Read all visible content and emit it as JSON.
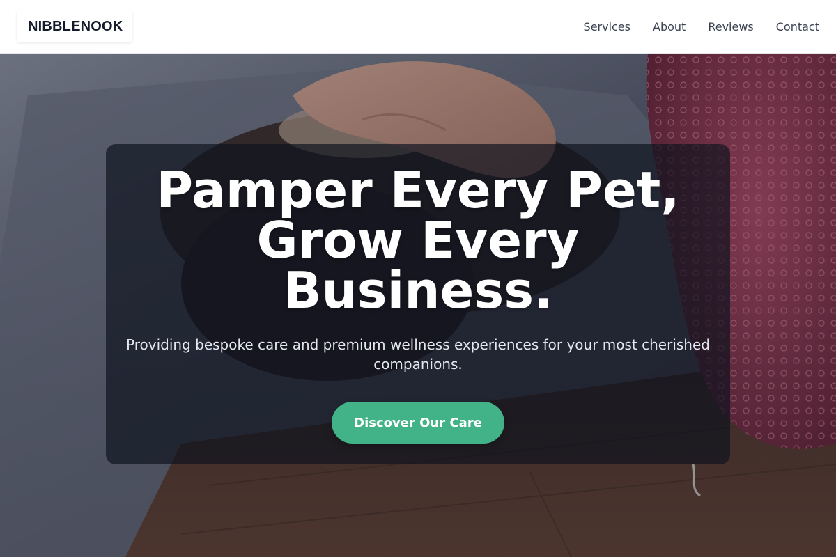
{
  "brand": {
    "name": "NIBBLENOOK"
  },
  "nav": {
    "items": [
      {
        "label": "Services"
      },
      {
        "label": "About"
      },
      {
        "label": "Reviews"
      },
      {
        "label": "Contact"
      }
    ]
  },
  "hero": {
    "title": "Pamper Every Pet, Grow Every Business.",
    "subtitle": "Providing bespoke care and premium wellness experiences for your most cherished companions.",
    "cta_label": "Discover Our Care",
    "background_image": "hand-petting-dog-photo"
  },
  "colors": {
    "accent": "#42b389",
    "brand_text": "#141b2b",
    "nav_text": "#3a4150",
    "overlay": "#0e121e"
  }
}
